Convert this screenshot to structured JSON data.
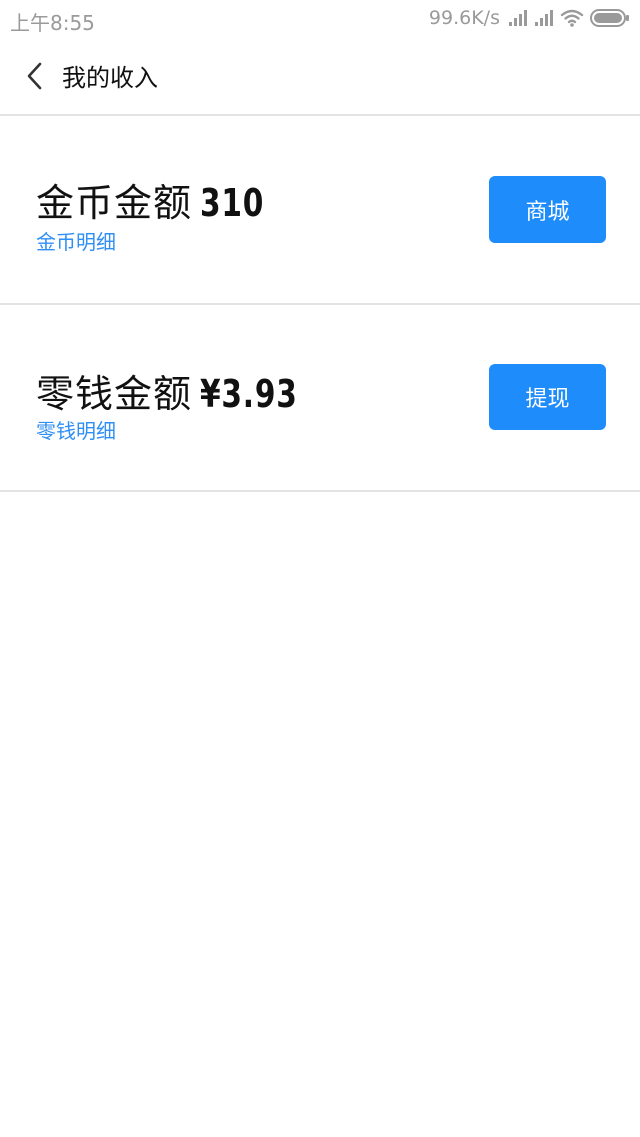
{
  "status_bar": {
    "time": "上午8:55",
    "net_speed": "99.6K/s",
    "icons": [
      "signal-icon",
      "signal-icon",
      "wifi-icon",
      "battery-icon"
    ]
  },
  "header": {
    "back_icon": "chevron-left-icon",
    "title": "我的收入"
  },
  "coins": {
    "label": "金币金额",
    "value": "310",
    "detail_link": "金币明细",
    "button_label": "商城"
  },
  "cash": {
    "label": "零钱金额",
    "value": "¥3.93",
    "detail_link": "零钱明细",
    "button_label": "提现"
  },
  "colors": {
    "accent": "#1f8cfb",
    "link": "#2f8ff5",
    "divider": "#e3e3e3",
    "status_text": "#9a9a9a"
  }
}
